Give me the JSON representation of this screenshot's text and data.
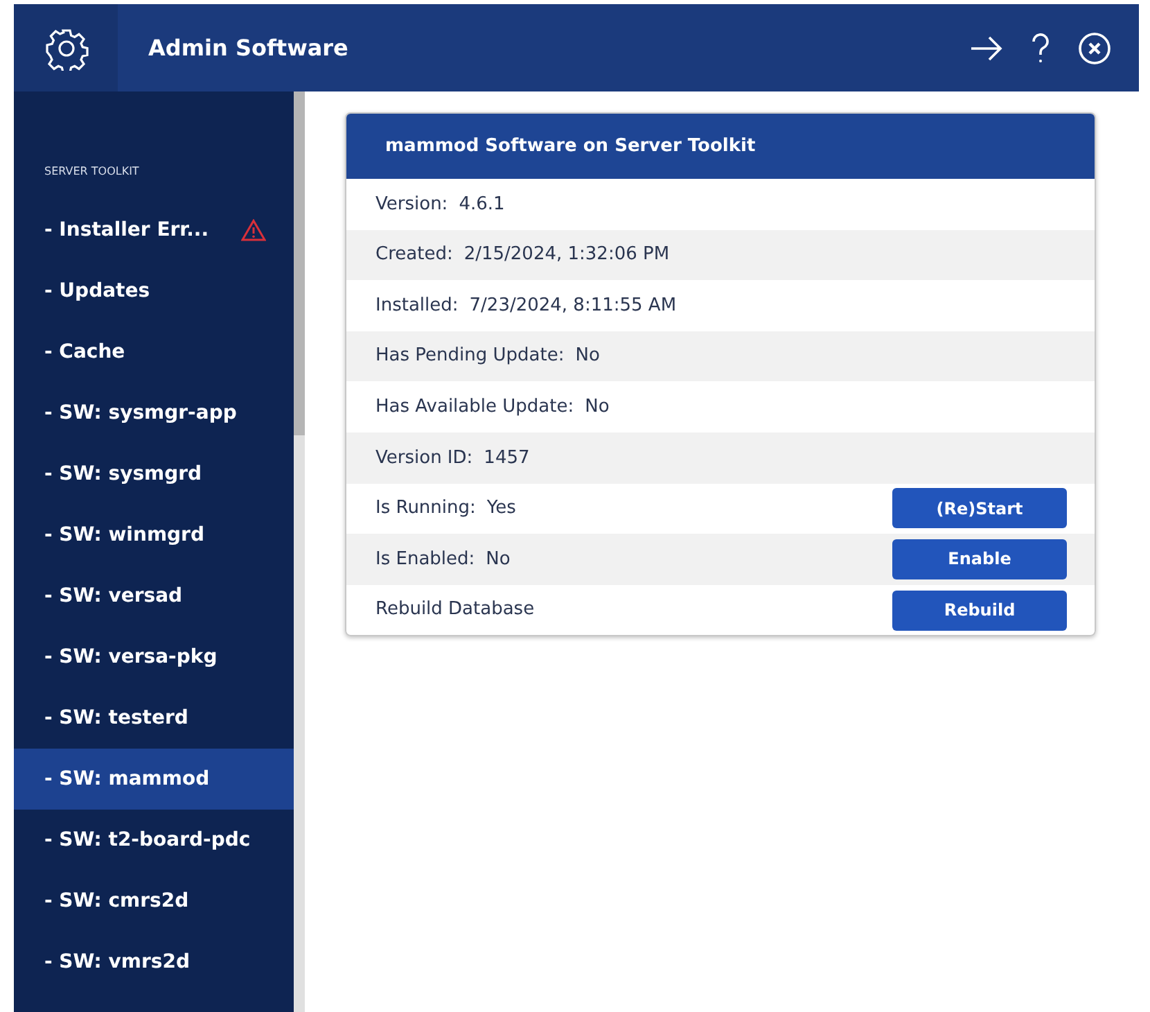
{
  "header": {
    "title": "Admin Software"
  },
  "sidebar": {
    "section": "SERVER TOOLKIT",
    "items": [
      {
        "label": "- Installer Err...",
        "selected": false,
        "warning": true
      },
      {
        "label": "- Updates",
        "selected": false,
        "warning": false
      },
      {
        "label": "- Cache",
        "selected": false,
        "warning": false
      },
      {
        "label": "- SW: sysmgr-app",
        "selected": false,
        "warning": false
      },
      {
        "label": "- SW: sysmgrd",
        "selected": false,
        "warning": false
      },
      {
        "label": "- SW: winmgrd",
        "selected": false,
        "warning": false
      },
      {
        "label": "- SW: versad",
        "selected": false,
        "warning": false
      },
      {
        "label": "- SW: versa-pkg",
        "selected": false,
        "warning": false
      },
      {
        "label": "- SW: testerd",
        "selected": false,
        "warning": false
      },
      {
        "label": "- SW: mammod",
        "selected": true,
        "warning": false
      },
      {
        "label": "- SW: t2-board-pdc",
        "selected": false,
        "warning": false
      },
      {
        "label": "- SW: cmrs2d",
        "selected": false,
        "warning": false
      },
      {
        "label": "- SW: vmrs2d",
        "selected": false,
        "warning": false
      }
    ]
  },
  "panel": {
    "title": "mammod Software on Server Toolkit",
    "rows": [
      {
        "label": "Version:",
        "value": "4.6.1"
      },
      {
        "label": "Created:",
        "value": "2/15/2024, 1:32:06 PM"
      },
      {
        "label": "Installed:",
        "value": "7/23/2024, 8:11:55 AM"
      },
      {
        "label": "Has Pending Update:",
        "value": "No"
      },
      {
        "label": "Has Available Update:",
        "value": "No"
      },
      {
        "label": "Version ID:",
        "value": "1457"
      },
      {
        "label": "Is Running:",
        "value": "Yes",
        "button": "(Re)Start"
      },
      {
        "label": "Is Enabled:",
        "value": "No",
        "button": "Enable"
      },
      {
        "label": "Rebuild Database",
        "button": "Rebuild"
      }
    ]
  }
}
